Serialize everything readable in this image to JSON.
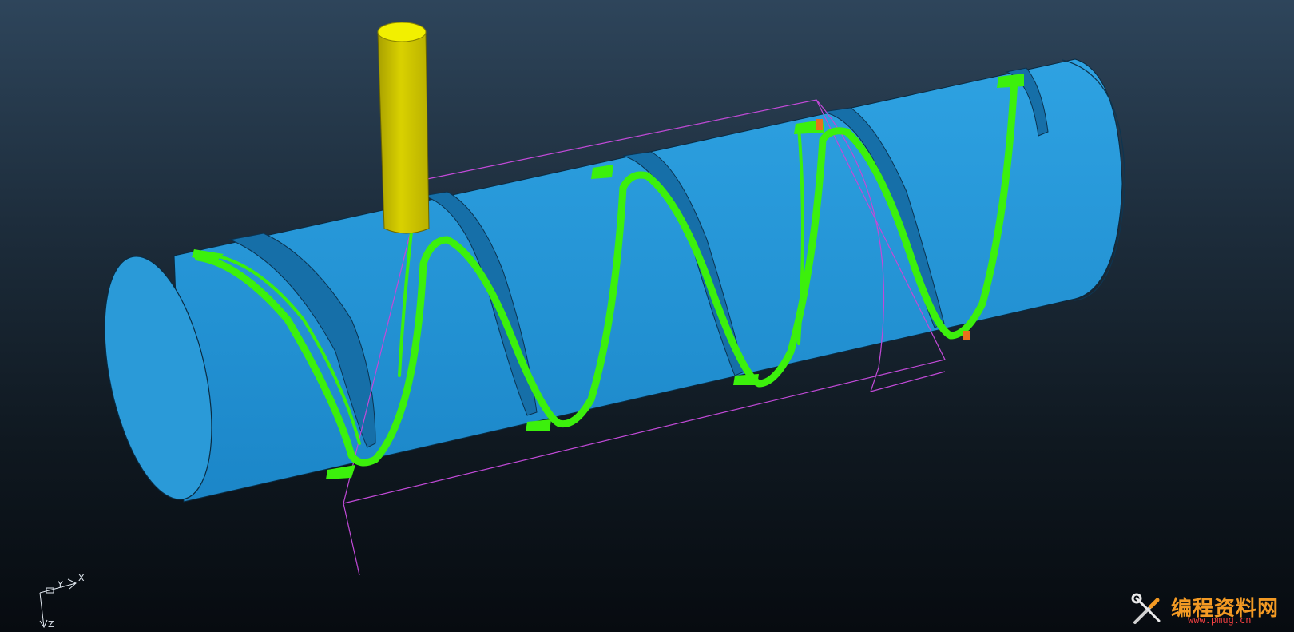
{
  "viewport": {
    "triad": {
      "x_label": "X",
      "y_label": "Y",
      "z_label": "Z"
    }
  },
  "watermark": {
    "title": "编程资料网",
    "url": "www.pmug.cn",
    "logo_icon": "wrench-screwdriver-icon"
  },
  "colors": {
    "background_top": "#2e455b",
    "background_bottom": "#070b10",
    "workpiece": "#2196d8",
    "toolpath": "#3cf00c",
    "tool": "#d8d000",
    "boundary": "#c24ad8",
    "marker": "#e8701c"
  }
}
